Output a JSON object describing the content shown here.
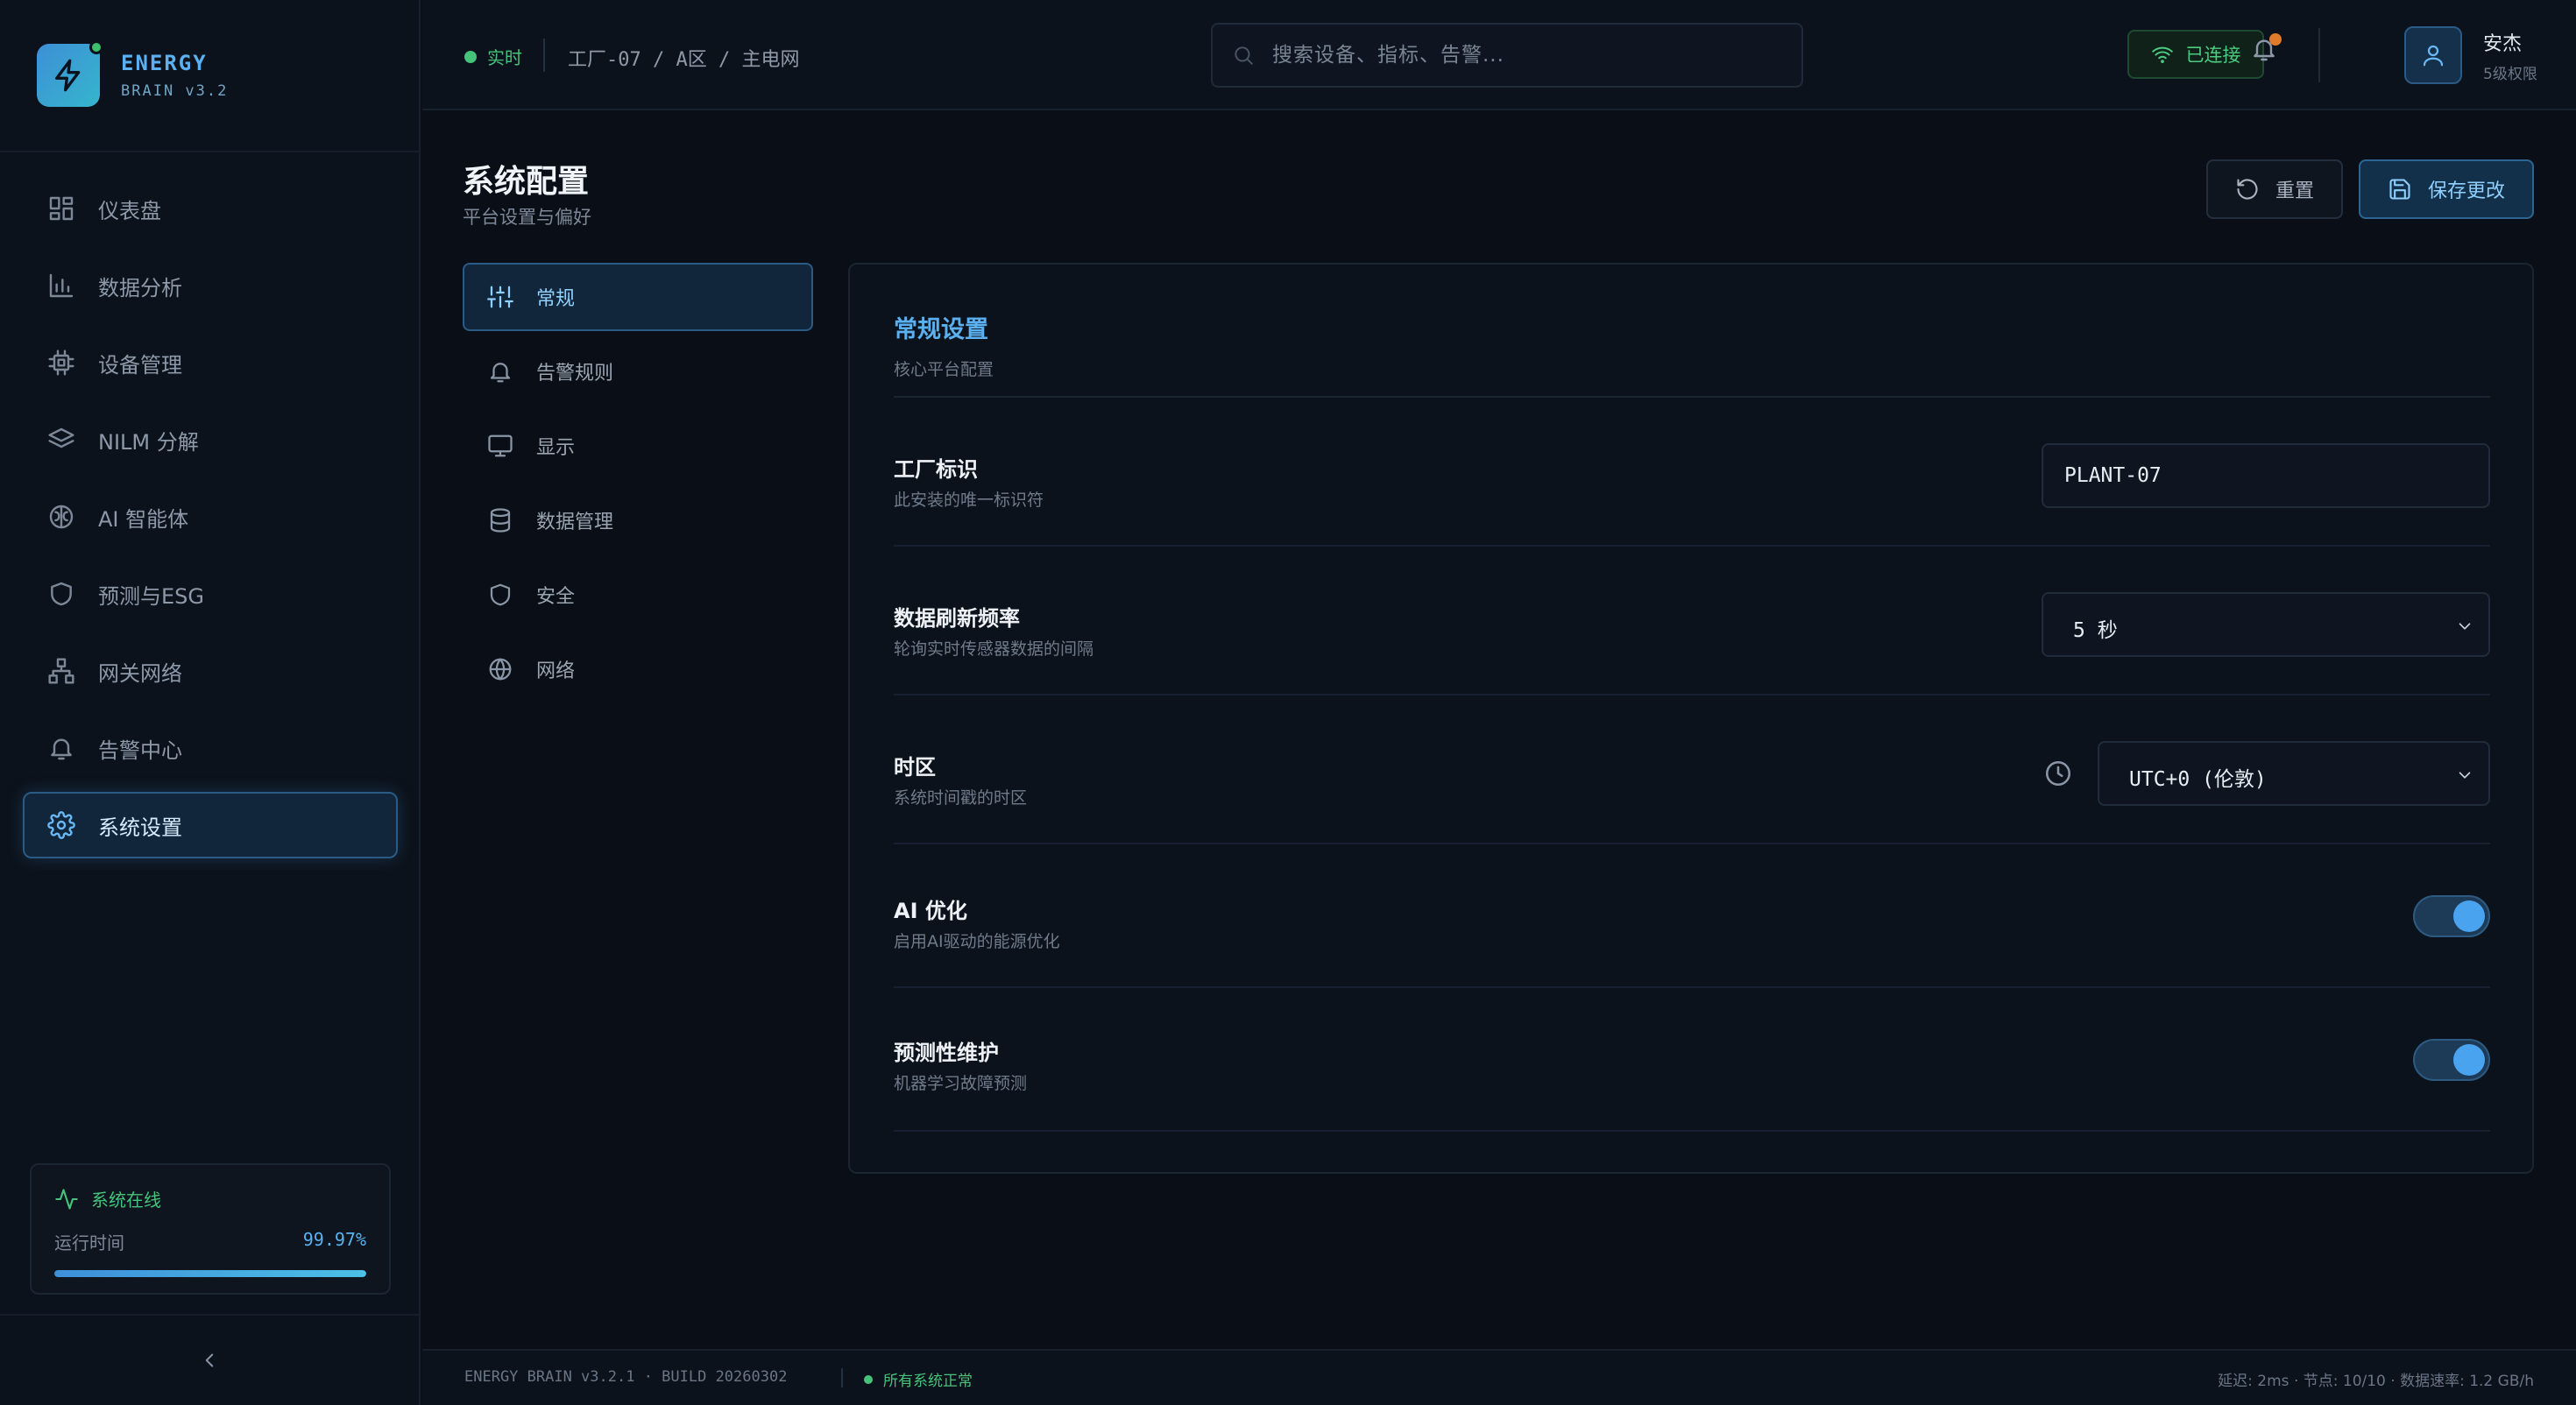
{
  "brand": {
    "name": "ENERGY",
    "version": "BRAIN v3.2"
  },
  "sidebar": {
    "items": [
      {
        "label": "仪表盘",
        "icon": "dashboard-icon"
      },
      {
        "label": "数据分析",
        "icon": "bar-chart-icon"
      },
      {
        "label": "设备管理",
        "icon": "chip-icon"
      },
      {
        "label": "NILM 分解",
        "icon": "layers-icon"
      },
      {
        "label": "AI 智能体",
        "icon": "brain-icon"
      },
      {
        "label": "预测与ESG",
        "icon": "shield-icon"
      },
      {
        "label": "网关网络",
        "icon": "network-icon"
      },
      {
        "label": "告警中心",
        "icon": "bell-icon"
      },
      {
        "label": "系统设置",
        "icon": "gear-icon",
        "active": true
      }
    ],
    "status": {
      "label": "系统在线",
      "uptime_label": "运行时间",
      "uptime_value": "99.97%",
      "uptime_fraction": 0.9997
    }
  },
  "topbar": {
    "live": "实时",
    "breadcrumb": "工厂-07 / A区 / 主电网",
    "search_placeholder": "搜索设备、指标、告警...",
    "connection": "已连接",
    "user": {
      "name": "安杰",
      "role": "5级权限"
    }
  },
  "page": {
    "title": "系统配置",
    "subtitle": "平台设置与偏好",
    "reset_label": "重置",
    "save_label": "保存更改"
  },
  "config_nav": [
    {
      "label": "常规",
      "icon": "sliders-icon",
      "active": true
    },
    {
      "label": "告警规则",
      "icon": "bell-icon"
    },
    {
      "label": "显示",
      "icon": "monitor-icon"
    },
    {
      "label": "数据管理",
      "icon": "database-icon"
    },
    {
      "label": "安全",
      "icon": "shield-icon"
    },
    {
      "label": "网络",
      "icon": "globe-icon"
    }
  ],
  "panel": {
    "title": "常规设置",
    "subtitle": "核心平台配置",
    "settings": [
      {
        "label": "工厂标识",
        "desc": "此安装的唯一标识符",
        "value": "PLANT-07"
      },
      {
        "label": "数据刷新频率",
        "desc": "轮询实时传感器数据的间隔",
        "value": "5 秒"
      },
      {
        "label": "时区",
        "desc": "系统时间戳的时区",
        "value": "UTC+0 (伦敦)"
      },
      {
        "label": "AI 优化",
        "desc": "启用AI驱动的能源优化",
        "enabled": true
      },
      {
        "label": "预测性维护",
        "desc": "机器学习故障预测",
        "enabled": true
      }
    ]
  },
  "footer": {
    "build": "ENERGY BRAIN v3.2.1 · BUILD 20260302",
    "status": "所有系统正常",
    "stats": "延迟: 2ms · 节点: 10/10 · 数据速率: 1.2 GB/h"
  },
  "colors": {
    "accent": "#5ab0f0",
    "success": "#46c37a",
    "notify": "#e07a2c",
    "background": "#0a0f17"
  }
}
